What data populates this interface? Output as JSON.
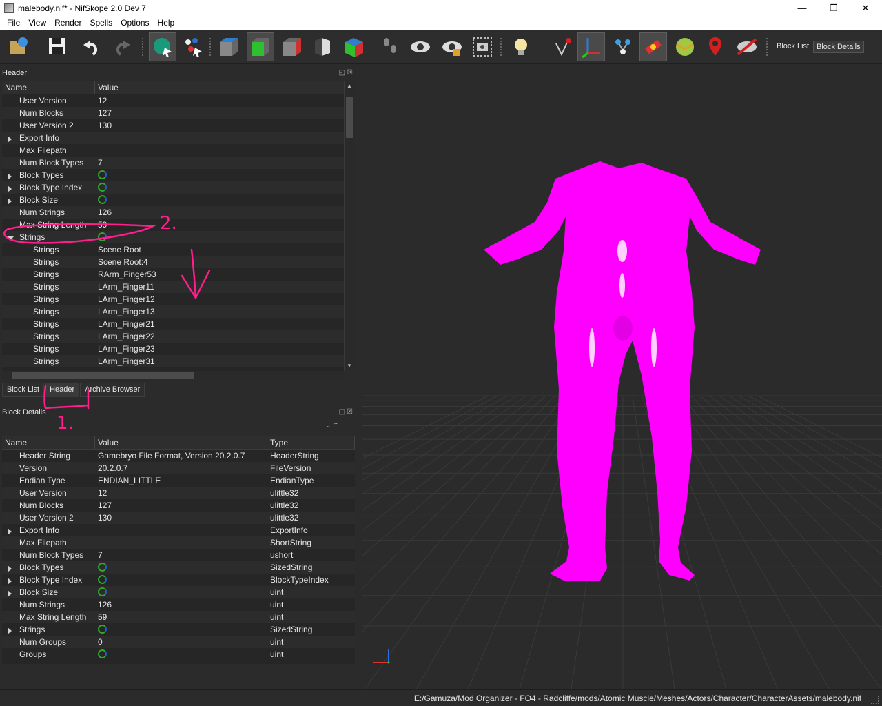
{
  "window": {
    "title": "malebody.nif* - NifSkope 2.0 Dev 7",
    "controls": {
      "minimize": "—",
      "maximize": "❐",
      "close": "✕"
    }
  },
  "menu": [
    "File",
    "View",
    "Render",
    "Spells",
    "Options",
    "Help"
  ],
  "toolbar": {
    "icons": [
      "load-icon",
      "save-icon",
      "undo-icon",
      "redo-icon",
      "select-object-icon",
      "select-vertex-icon",
      "view-front-icon",
      "view-top-icon",
      "view-side-icon",
      "view-user-icon",
      "view-walk-icon",
      "footsteps-icon",
      "show-hidden-icon",
      "show-nodes-icon",
      "screenshot-icon",
      "lighting-icon",
      "pick-icon",
      "axes-icon",
      "nodes-icon",
      "constraints-icon",
      "markers-icon",
      "location-icon",
      "hide-icon"
    ],
    "block_list_label": "Block List",
    "block_details_label": "Block Details"
  },
  "header_panel": {
    "title": "Header",
    "columns": [
      "Name",
      "Value"
    ],
    "rows": [
      {
        "name": "User Version",
        "value": "12",
        "expand": "",
        "icon": false
      },
      {
        "name": "Num Blocks",
        "value": "127",
        "expand": "",
        "icon": false
      },
      {
        "name": "User Version 2",
        "value": "130",
        "expand": "",
        "icon": false
      },
      {
        "name": "Export Info",
        "value": "",
        "expand": "closed",
        "icon": false
      },
      {
        "name": "Max Filepath",
        "value": "",
        "expand": "",
        "icon": false
      },
      {
        "name": "Num Block Types",
        "value": "7",
        "expand": "",
        "icon": false
      },
      {
        "name": "Block Types",
        "value": "",
        "expand": "closed",
        "icon": true
      },
      {
        "name": "Block Type Index",
        "value": "",
        "expand": "closed",
        "icon": true
      },
      {
        "name": "Block Size",
        "value": "",
        "expand": "closed",
        "icon": true
      },
      {
        "name": "Num Strings",
        "value": "126",
        "expand": "",
        "icon": false
      },
      {
        "name": "Max String Length",
        "value": "59",
        "expand": "",
        "icon": false
      },
      {
        "name": "Strings",
        "value": "",
        "expand": "open",
        "icon": true
      },
      {
        "name": "Strings",
        "value": "Scene Root",
        "expand": "child",
        "icon": false
      },
      {
        "name": "Strings",
        "value": "Scene Root:4",
        "expand": "child",
        "icon": false
      },
      {
        "name": "Strings",
        "value": "RArm_Finger53",
        "expand": "child",
        "icon": false
      },
      {
        "name": "Strings",
        "value": "LArm_Finger11",
        "expand": "child",
        "icon": false
      },
      {
        "name": "Strings",
        "value": "LArm_Finger12",
        "expand": "child",
        "icon": false
      },
      {
        "name": "Strings",
        "value": "LArm_Finger13",
        "expand": "child",
        "icon": false
      },
      {
        "name": "Strings",
        "value": "LArm_Finger21",
        "expand": "child",
        "icon": false
      },
      {
        "name": "Strings",
        "value": "LArm_Finger22",
        "expand": "child",
        "icon": false
      },
      {
        "name": "Strings",
        "value": "LArm_Finger23",
        "expand": "child",
        "icon": false
      },
      {
        "name": "Strings",
        "value": "LArm_Finger31",
        "expand": "child",
        "icon": false
      }
    ]
  },
  "tabs": [
    "Block List",
    "Header",
    "Archive Browser"
  ],
  "details_panel": {
    "title": "Block Details",
    "columns": [
      "Name",
      "Value",
      "Type"
    ],
    "rows": [
      {
        "name": "Header String",
        "value": "Gamebryo File Format, Version 20.2.0.7",
        "type": "HeaderString",
        "expand": "",
        "icon": false
      },
      {
        "name": "Version",
        "value": "20.2.0.7",
        "type": "FileVersion",
        "expand": "",
        "icon": false
      },
      {
        "name": "Endian Type",
        "value": "ENDIAN_LITTLE",
        "type": "EndianType",
        "expand": "",
        "icon": false
      },
      {
        "name": "User Version",
        "value": "12",
        "type": "ulittle32",
        "expand": "",
        "icon": false
      },
      {
        "name": "Num Blocks",
        "value": "127",
        "type": "ulittle32",
        "expand": "",
        "icon": false
      },
      {
        "name": "User Version 2",
        "value": "130",
        "type": "ulittle32",
        "expand": "",
        "icon": false
      },
      {
        "name": "Export Info",
        "value": "",
        "type": "ExportInfo",
        "expand": "closed",
        "icon": false
      },
      {
        "name": "Max Filepath",
        "value": "",
        "type": "ShortString",
        "expand": "",
        "icon": false
      },
      {
        "name": "Num Block Types",
        "value": "7",
        "type": "ushort",
        "expand": "",
        "icon": false
      },
      {
        "name": "Block Types",
        "value": "",
        "type": "SizedString",
        "expand": "closed",
        "icon": true
      },
      {
        "name": "Block Type Index",
        "value": "",
        "type": "BlockTypeIndex",
        "expand": "closed",
        "icon": true
      },
      {
        "name": "Block Size",
        "value": "",
        "type": "uint",
        "expand": "closed",
        "icon": true
      },
      {
        "name": "Num Strings",
        "value": "126",
        "type": "uint",
        "expand": "",
        "icon": false
      },
      {
        "name": "Max String Length",
        "value": "59",
        "type": "uint",
        "expand": "",
        "icon": false
      },
      {
        "name": "Strings",
        "value": "",
        "type": "SizedString",
        "expand": "closed",
        "icon": true
      },
      {
        "name": "Num Groups",
        "value": "0",
        "type": "uint",
        "expand": "",
        "icon": false
      },
      {
        "name": "Groups",
        "value": "",
        "type": "uint",
        "expand": "",
        "icon": true
      }
    ]
  },
  "annotations": {
    "one": "1.",
    "two": "2."
  },
  "status": {
    "path": "E:/Gamuza/Mod Organizer - FO4 - Radcliffe/mods/Atomic Muscle/Meshes/Actors/Character/CharacterAssets/malebody.nif"
  },
  "colors": {
    "mesh": "#ff00ff",
    "annotation": "#ff1e8c",
    "background": "#2b2b2b"
  }
}
